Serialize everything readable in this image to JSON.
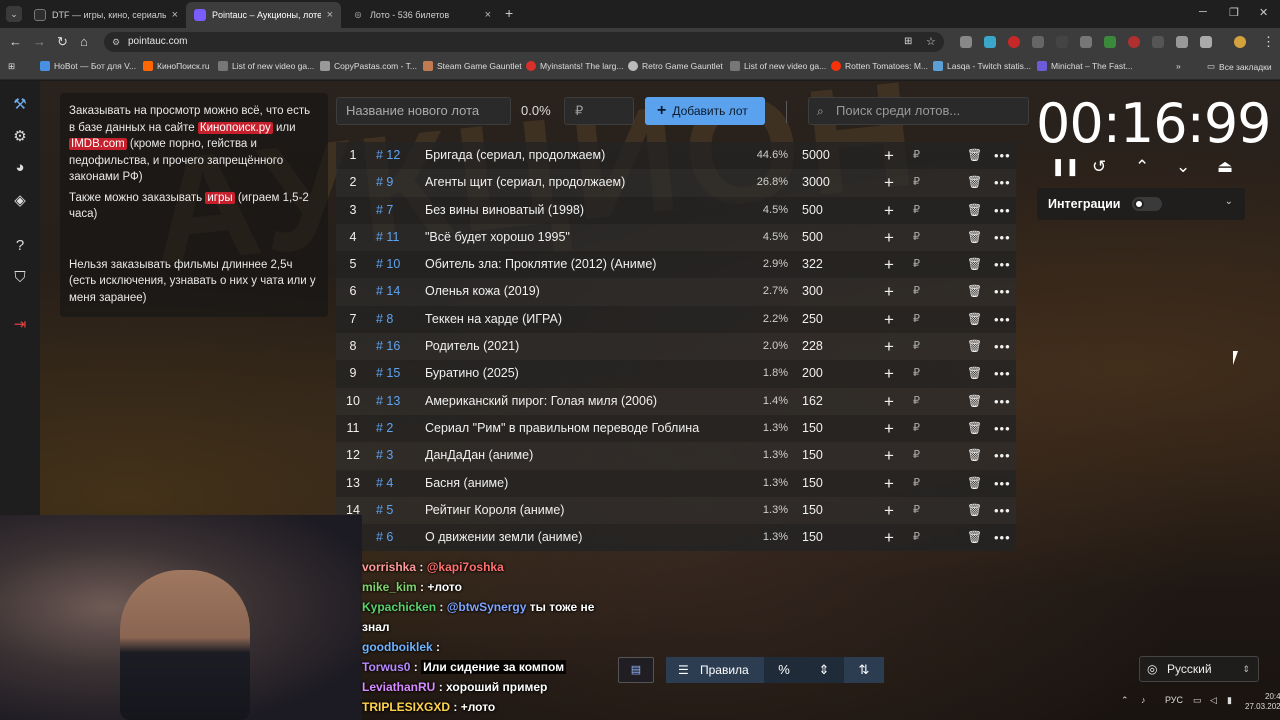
{
  "browser": {
    "tabs": [
      {
        "label": "DTF — игры, кино, сериалы, р",
        "favicon_color": "#2d2d2d"
      },
      {
        "label": "Pointauc – Аукционы, лотерей",
        "favicon_color": "#7b5cff"
      },
      {
        "label": "Лото - 536 билетов",
        "favicon_color": "#555555"
      }
    ],
    "url": "pointauc.com",
    "bookmarks": [
      {
        "label": "HoBot — Бот для V...",
        "color": "#4a90e2"
      },
      {
        "label": "КиноПоиск.ru",
        "color": "#ff6600"
      },
      {
        "label": "List of new video ga...",
        "color": "#777777"
      },
      {
        "label": "CopyPastas.com - T...",
        "color": "#999999"
      },
      {
        "label": "Steam Game Gauntlet",
        "color": "#c27a52"
      },
      {
        "label": "Myinstants! The larg...",
        "color": "#d9302c"
      },
      {
        "label": "Retro Game Gauntlet",
        "color": "#bbbbbb"
      },
      {
        "label": "List of new video ga...",
        "color": "#777777"
      },
      {
        "label": "Rotten Tomatoes: M...",
        "color": "#fa320a"
      },
      {
        "label": "Lasqa - Twitch statis...",
        "color": "#5a9fd6"
      },
      {
        "label": "Minichat – The Fast...",
        "color": "#6b5bd6"
      }
    ],
    "all_bookmarks": "Все закладки"
  },
  "sidebar": {
    "icons": [
      "gavel-icon",
      "gear-icon",
      "pie-chart-icon",
      "layers-icon",
      "help-icon",
      "shield-icon",
      "logout-icon"
    ]
  },
  "info": {
    "p1_a": "Заказывать на просмотр можно всё, что есть в базе данных на сайте ",
    "p1_link1": "Кинопоиск.ру",
    "p1_b": " или ",
    "p1_link2": "IMDB.com",
    "p1_c": " (кроме порно, гейства и педофильства, и прочего запрещённого законами РФ)",
    "p2_a": "Также можно заказывать ",
    "p2_link": "игры",
    "p2_b": " (играем 1,5-2 часа)",
    "p3": "Нельзя заказывать фильмы длиннее 2,5ч (есть исключения, узнавать о них у чата или у меня заранее)"
  },
  "controls": {
    "lot_name_placeholder": "Название нового лота",
    "percent": "0.0%",
    "amount_placeholder": "₽",
    "add_button": "Добавить лот",
    "search_placeholder": "Поиск среди лотов..."
  },
  "lots": [
    {
      "rank": "1",
      "id": "# 12",
      "name": "Бригада (сериал, продолжаем)",
      "pct": "44.6%",
      "amount": "5000"
    },
    {
      "rank": "2",
      "id": "# 9",
      "name": "Агенты щит (сериал, продолжаем)",
      "pct": "26.8%",
      "amount": "3000"
    },
    {
      "rank": "3",
      "id": "# 7",
      "name": "Без вины виноватый (1998)",
      "pct": "4.5%",
      "amount": "500"
    },
    {
      "rank": "4",
      "id": "# 11",
      "name": "\"Всё будет хорошо 1995\"",
      "pct": "4.5%",
      "amount": "500"
    },
    {
      "rank": "5",
      "id": "# 10",
      "name": "Обитель зла: Проклятие (2012) (Аниме)",
      "pct": "2.9%",
      "amount": "322"
    },
    {
      "rank": "6",
      "id": "# 14",
      "name": "Оленья кожа (2019)",
      "pct": "2.7%",
      "amount": "300"
    },
    {
      "rank": "7",
      "id": "# 8",
      "name": "Теккен на харде (ИГРА)",
      "pct": "2.2%",
      "amount": "250"
    },
    {
      "rank": "8",
      "id": "# 16",
      "name": "Родитель (2021)",
      "pct": "2.0%",
      "amount": "228"
    },
    {
      "rank": "9",
      "id": "# 15",
      "name": "Буратино (2025)",
      "pct": "1.8%",
      "amount": "200"
    },
    {
      "rank": "10",
      "id": "# 13",
      "name": "Американский пирог: Голая миля (2006)",
      "pct": "1.4%",
      "amount": "162"
    },
    {
      "rank": "11",
      "id": "# 2",
      "name": "Сериал \"Рим\" в правильном переводе Гоблина",
      "pct": "1.3%",
      "amount": "150"
    },
    {
      "rank": "12",
      "id": "# 3",
      "name": "ДанДаДан (аниме)",
      "pct": "1.3%",
      "amount": "150"
    },
    {
      "rank": "13",
      "id": "# 4",
      "name": "Басня (аниме)",
      "pct": "1.3%",
      "amount": "150"
    },
    {
      "rank": "14",
      "id": "# 5",
      "name": "Рейтинг Короля (аниме)",
      "pct": "1.3%",
      "amount": "150"
    },
    {
      "rank": "",
      "id": "# 6",
      "name": "О движении земли (аниме)",
      "pct": "1.3%",
      "amount": "150"
    }
  ],
  "row_actions": {
    "plus": "+",
    "rub": "₽",
    "delete_icon": "trash-icon",
    "more": "•••"
  },
  "timer": {
    "value": "00:16:99"
  },
  "integrations": {
    "label": "Интеграции"
  },
  "chat": [
    {
      "user": "vorrishka",
      "sep": " : ",
      "mention": "@kapi7oshka",
      "text": ""
    },
    {
      "user": "mike_kim",
      "sep": " : ",
      "mention": "",
      "text": "+лото"
    },
    {
      "user": "Kypachicken",
      "sep": " : ",
      "mention": "@btwSynergy",
      "text": " ты тоже не"
    },
    {
      "user": "",
      "sep": "",
      "mention": "",
      "text": "знал"
    },
    {
      "user": "goodboiklek",
      "sep": " : ",
      "mention": "",
      "text": ""
    },
    {
      "user": "Torwus0",
      "sep": " : ",
      "mention": "",
      "text": "Или сидение за компом"
    },
    {
      "user": "LeviathanRU",
      "sep": " : ",
      "mention": "",
      "text": "хороший пример"
    },
    {
      "user": "TRIPLESIXGXD",
      "sep": " : ",
      "mention": "",
      "text": "+лото"
    }
  ],
  "bottom_bar": {
    "rules": "Правила",
    "percent": "%"
  },
  "language": {
    "label": "Русский"
  },
  "tray": {
    "lang": "РУС",
    "time": "20:42",
    "date": "27.03.2026"
  }
}
